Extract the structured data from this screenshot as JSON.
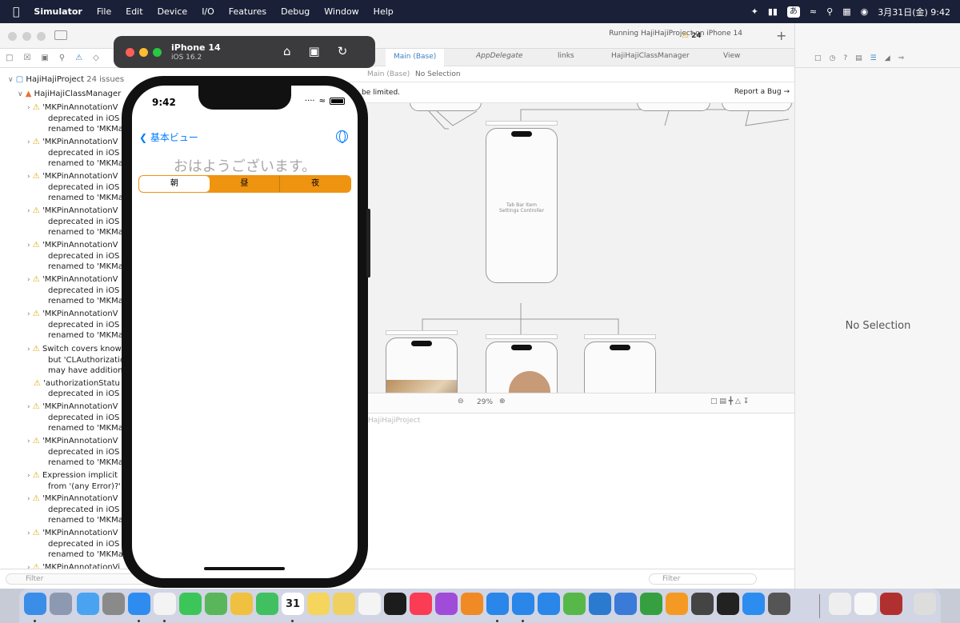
{
  "menubar": {
    "app_name": "Simulator",
    "items": [
      "File",
      "Edit",
      "Device",
      "I/O",
      "Features",
      "Debug",
      "Window",
      "Help"
    ],
    "ime": "あ",
    "clock": "3月31日(金) 9:42"
  },
  "toolbar": {
    "project": "HajiHajiProject",
    "device": "iPhone 14",
    "status": "Running HajiHajiProject on iPhone 14",
    "warning_count": "24"
  },
  "navigator": {
    "project_row": "HajiHajiProject",
    "project_issues": "24 issues",
    "group_row": "HajiHajiClassManager",
    "filter_placeholder": "Filter",
    "issues": [
      {
        "l1": "'MKPinAnnotationV",
        "l2": "deprecated in iOS",
        "l3": "renamed to 'MKMa"
      },
      {
        "l1": "'MKPinAnnotationV",
        "l2": "deprecated in iOS",
        "l3": "renamed to 'MKMa"
      },
      {
        "l1": "'MKPinAnnotationV",
        "l2": "deprecated in iOS",
        "l3": "renamed to 'MKMa"
      },
      {
        "l1": "'MKPinAnnotationV",
        "l2": "deprecated in iOS",
        "l3": "renamed to 'MKMa"
      },
      {
        "l1": "'MKPinAnnotationV",
        "l2": "deprecated in iOS",
        "l3": "renamed to 'MKMa"
      },
      {
        "l1": "'MKPinAnnotationV",
        "l2": "deprecated in iOS",
        "l3": "renamed to 'MKMa"
      },
      {
        "l1": "'MKPinAnnotationV",
        "l2": "deprecated in iOS",
        "l3": "renamed to 'MKMa"
      },
      {
        "l1": "Switch covers know",
        "l2": "but 'CLAuthorizatio",
        "l3": "may have additiona"
      },
      {
        "l1": "'authorizationStatu",
        "l2": "deprecated in iOS",
        "l3": ""
      },
      {
        "l1": "'MKPinAnnotationV",
        "l2": "deprecated in iOS",
        "l3": "renamed to 'MKMa"
      },
      {
        "l1": "'MKPinAnnotationV",
        "l2": "deprecated in iOS",
        "l3": "renamed to 'MKMa"
      },
      {
        "l1": "Expression implicit",
        "l2": "from '(any Error)?'",
        "l3": ""
      },
      {
        "l1": "'MKPinAnnotationV",
        "l2": "deprecated in iOS",
        "l3": "renamed to 'MKMa"
      },
      {
        "l1": "'MKPinAnnotationV",
        "l2": "deprecated in iOS",
        "l3": "renamed to 'MKMa"
      },
      {
        "l1": "'MKPinAnnotationVi",
        "l2": "",
        "l3": ""
      }
    ]
  },
  "editor": {
    "tabs": [
      "Main (Base)",
      "AppDelegate",
      "links",
      "HajiHajiClassManager",
      "View"
    ],
    "jump_main": "Main (Base)",
    "jump_sel": "No Selection",
    "notice": "be limited.",
    "report_bug": "Report a Bug",
    "zoom": "29%",
    "scene_label_settings": "Tab Bar Item\nSettings Controller",
    "debug_title": "HajiHajiProject",
    "debug_filter": "Filter"
  },
  "inspector": {
    "no_selection": "No Selection"
  },
  "simulator": {
    "device_name": "iPhone 14",
    "os_version": "iOS 16.2",
    "dot_colors": [
      "#ff5f57",
      "#febc2e",
      "#28c840"
    ]
  },
  "app": {
    "time": "9:42",
    "back_label": "基本ビュー",
    "greeting": "おはようございます。",
    "segments": [
      "朝",
      "昼",
      "夜"
    ],
    "selected_segment": "朝",
    "accent_color": "#ee9411",
    "tint_color": "#007aff"
  },
  "dock": {
    "calendar_day": "31",
    "apps": [
      "Finder",
      "Launchpad",
      "Mail",
      "System Settings",
      "Safari",
      "Chrome",
      "Messages",
      "Maps",
      "Photos",
      "FaceTime",
      "Calendar",
      "Notes",
      "Stickies",
      "Reminders",
      "TV",
      "Music",
      "Podcasts",
      "Books",
      "Simulator",
      "Xcode",
      "App Store",
      "Numbers",
      "VS Code",
      "Keynote",
      "Numbers 2",
      "Pages",
      "Chess",
      "Terminal",
      "Zoom",
      "Calculator",
      "Preview",
      "TextEdit",
      "Dictionary",
      "Trash"
    ]
  }
}
